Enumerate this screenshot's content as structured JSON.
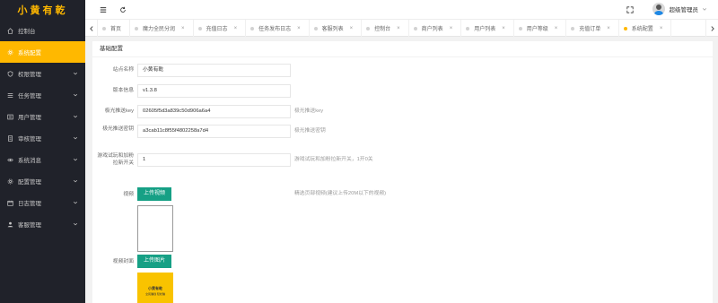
{
  "app": {
    "logo": "小黄有乾"
  },
  "sidebar": {
    "items": [
      {
        "label": "控制台",
        "icon": "home-icon",
        "expandable": false,
        "active": false
      },
      {
        "label": "系统配置",
        "icon": "gear-icon",
        "expandable": false,
        "active": true
      },
      {
        "label": "权限管理",
        "icon": "shield-icon",
        "expandable": true,
        "active": false
      },
      {
        "label": "任务管理",
        "icon": "list-icon",
        "expandable": true,
        "active": false
      },
      {
        "label": "用户管理",
        "icon": "users-icon",
        "expandable": true,
        "active": false
      },
      {
        "label": "审核管理",
        "icon": "doc-icon",
        "expandable": true,
        "active": false
      },
      {
        "label": "系统消息",
        "icon": "eye-icon",
        "expandable": true,
        "active": false
      },
      {
        "label": "配置管理",
        "icon": "gear-icon",
        "expandable": true,
        "active": false
      },
      {
        "label": "日志管理",
        "icon": "calendar-icon",
        "expandable": true,
        "active": false
      },
      {
        "label": "客服管理",
        "icon": "person-icon",
        "expandable": true,
        "active": false
      }
    ]
  },
  "header": {
    "user_name": "超级管理员"
  },
  "tabs": [
    {
      "label": "首页",
      "closable": false,
      "active": false
    },
    {
      "label": "魔力全民分润",
      "closable": true,
      "active": false
    },
    {
      "label": "充值日志",
      "closable": true,
      "active": false
    },
    {
      "label": "任务发布日志",
      "closable": true,
      "active": false
    },
    {
      "label": "客服列表",
      "closable": true,
      "active": false
    },
    {
      "label": "控制台",
      "closable": true,
      "active": false
    },
    {
      "label": "商户列表",
      "closable": true,
      "active": false
    },
    {
      "label": "用户列表",
      "closable": true,
      "active": false
    },
    {
      "label": "用户等级",
      "closable": true,
      "active": false
    },
    {
      "label": "充值订单",
      "closable": true,
      "active": false
    },
    {
      "label": "系统配置",
      "closable": true,
      "active": true
    }
  ],
  "form": {
    "title": "基础配置",
    "fields": {
      "site_name": {
        "label": "站点名称",
        "value": "小黄有乾"
      },
      "version": {
        "label": "版本信息",
        "value": "v1.3.8"
      },
      "jpush_key": {
        "label": "极光推送key",
        "value": "02605f5d3a839c50d906a6a4",
        "tip": "极光推送key"
      },
      "jpush_secret": {
        "label": "极光推送密钥",
        "value": "a3cab11c8f55f4802258a7d4",
        "tip": "极光推送密钥"
      },
      "game_switch": {
        "label": "游戏试玩和加粉拉新开关",
        "value": "1",
        "tip": "游戏试玩和加粉拉新开关，1开0关"
      },
      "video": {
        "label": "视频",
        "button": "上传视频",
        "tip": "精选页部视频(建议上传20M以下的视频)"
      },
      "video_cover": {
        "label": "视频封面",
        "button": "上传图片",
        "cover_text_1": "小黄有乾",
        "cover_text_2": "全民赚钱 轻松赚"
      }
    }
  },
  "colors": {
    "accent": "#ffb800",
    "sidebar_bg": "#20222a",
    "button_green": "#16a085"
  }
}
